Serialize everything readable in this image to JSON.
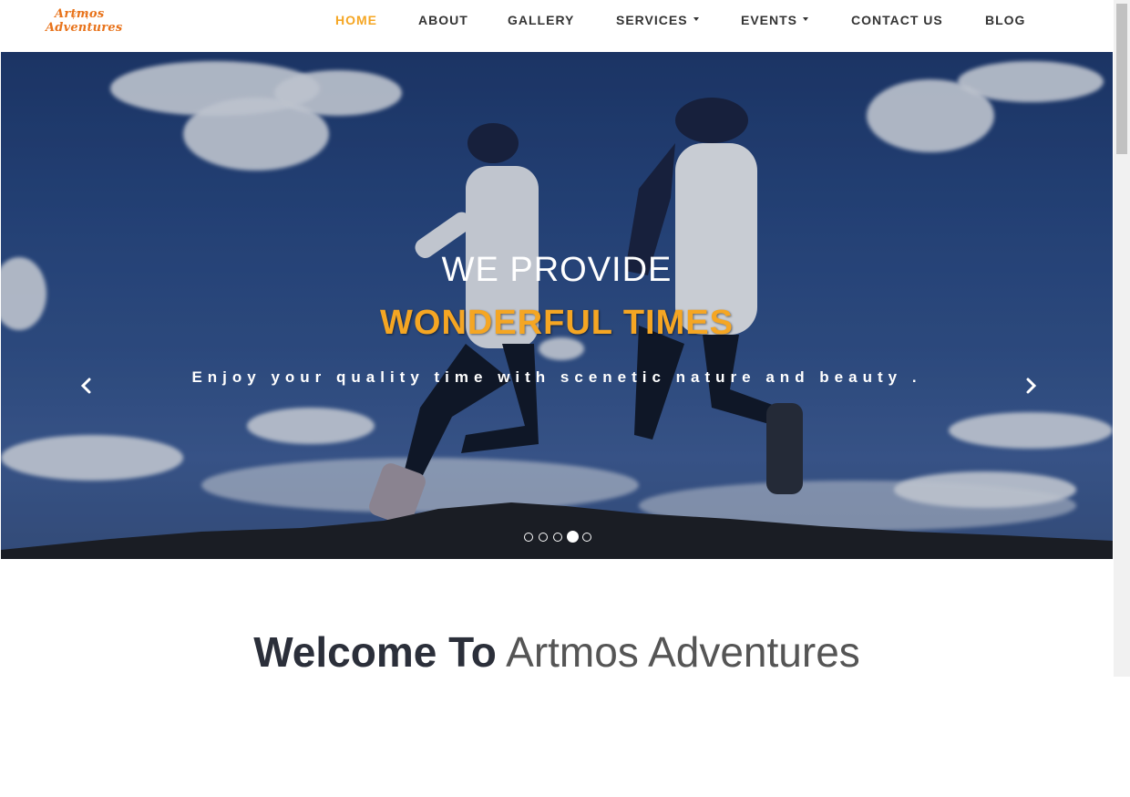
{
  "logo": {
    "line1": "Artmos",
    "line2": "Adventures"
  },
  "nav": {
    "items": [
      {
        "label": "HOME",
        "active": true
      },
      {
        "label": "ABOUT"
      },
      {
        "label": "GALLERY"
      },
      {
        "label": "SERVICES",
        "dropdown": true
      },
      {
        "label": "EVENTS",
        "dropdown": true
      },
      {
        "label": "CONTACT US"
      },
      {
        "label": "BLOG"
      }
    ]
  },
  "hero": {
    "line1": "WE PROVIDE",
    "line2": "WONDERFUL TIMES",
    "subtitle": "Enjoy your quality time with scenetic nature and beauty .",
    "prev_icon": "chevron-left-icon",
    "next_icon": "chevron-right-icon",
    "slide_count": 5,
    "active_slide": 4
  },
  "welcome": {
    "bold": "Welcome To",
    "light": "Artmos Adventures"
  },
  "colors": {
    "accent": "#f5a623",
    "logo": "#e8731b",
    "text": "#333333"
  }
}
